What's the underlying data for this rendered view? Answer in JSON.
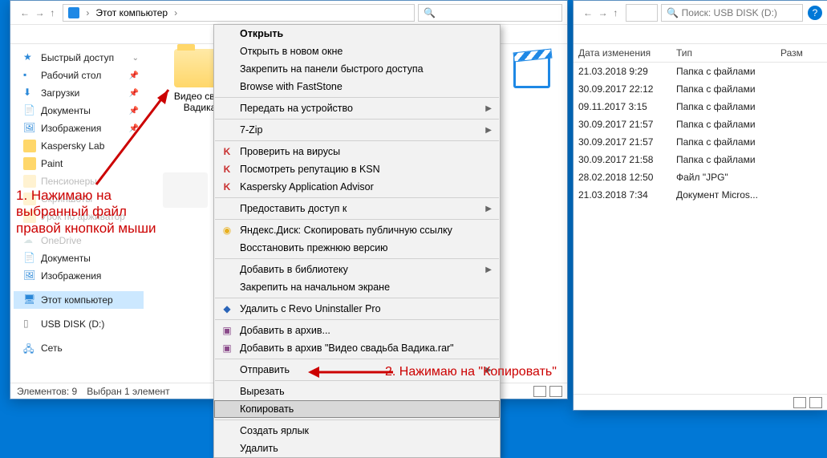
{
  "left": {
    "breadcrumb": [
      "Этот компьютер"
    ],
    "sidebar": {
      "quick": "Быстрый доступ",
      "desktop": "Рабочий стол",
      "downloads": "Загрузки",
      "documents": "Документы",
      "pictures": "Изображения",
      "kaspersky": "Kaspersky Lab",
      "paint": "Paint",
      "pens": "Пенсионеры",
      "screens": "Скриншоты",
      "lesson": "Урок по арживатор",
      "onedrive": "OneDrive",
      "docs2": "Документы",
      "pics2": "Изображения",
      "thispc": "Этот компьютер",
      "usb": "USB DISK (D:)",
      "net": "Сеть"
    },
    "folder_label": "Видео свад Вадика",
    "status_items": "Элементов: 9",
    "status_sel": "Выбран 1 элемент"
  },
  "right": {
    "search_placeholder": "Поиск: USB DISK (D:)",
    "cols": {
      "date": "Дата изменения",
      "type": "Тип",
      "size": "Разм"
    },
    "rows": [
      {
        "date": "21.03.2018 9:29",
        "type": "Папка с файлами"
      },
      {
        "date": "30.09.2017 22:12",
        "type": "Папка с файлами"
      },
      {
        "date": "09.11.2017 3:15",
        "type": "Папка с файлами"
      },
      {
        "date": "30.09.2017 21:57",
        "type": "Папка с файлами"
      },
      {
        "date": "30.09.2017 21:57",
        "type": "Папка с файлами"
      },
      {
        "date": "30.09.2017 21:58",
        "type": "Папка с файлами"
      },
      {
        "date": "28.02.2018 12:50",
        "type": "Файл \"JPG\""
      },
      {
        "date": "21.03.2018 7:34",
        "type": "Документ Micros..."
      }
    ]
  },
  "ctx": {
    "open": "Открыть",
    "open_new": "Открыть в новом окне",
    "pin_quick": "Закрепить на панели быстрого доступа",
    "faststone": "Browse with FastStone",
    "cast": "Передать на устройство",
    "sevenzip": "7-Zip",
    "scan": "Проверить на вирусы",
    "ksn": "Посмотреть репутацию в KSN",
    "kadvisor": "Kaspersky Application Advisor",
    "share": "Предоставить доступ к",
    "yadisk": "Яндекс.Диск: Скопировать публичную ссылку",
    "restore": "Восстановить прежнюю версию",
    "library": "Добавить в библиотеку",
    "pin_start": "Закрепить на начальном экране",
    "revo": "Удалить с Revo Uninstaller Pro",
    "arch1": "Добавить в архив...",
    "arch2": "Добавить в архив \"Видео свадьба Вадика.rar\"",
    "send": "Отправить",
    "cut": "Вырезать",
    "copy": "Копировать",
    "shortcut": "Создать ярлык",
    "delete": "Удалить"
  },
  "annot1_l1": "1. Нажимаю на",
  "annot1_l2": "выбранный файл",
  "annot1_l3": "правой кнопкой мыши",
  "annot2": "2. Нажимаю на \"Копировать\""
}
